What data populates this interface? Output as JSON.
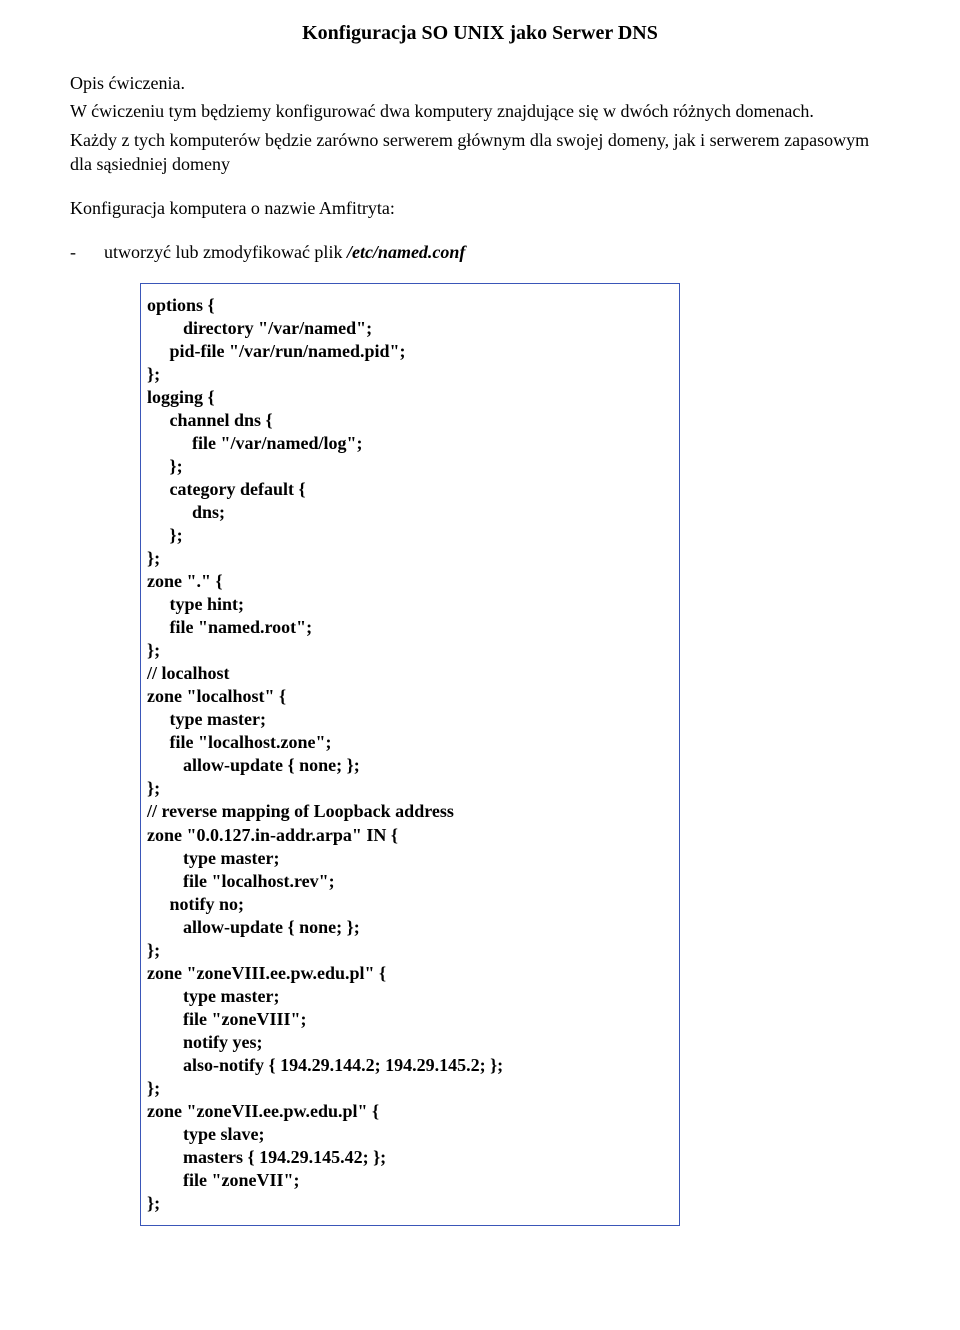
{
  "title": "Konfiguracja SO UNIX jako Serwer DNS",
  "intro": {
    "line1": "Opis ćwiczenia.",
    "line2": "W ćwiczeniu tym będziemy konfigurować dwa komputery znajdujące się w dwóch różnych domenach.",
    "line3": "Każdy z tych komputerów będzie zarówno serwerem głównym dla swojej domeny,  jak i serwerem zapasowym dla sąsiedniej domeny"
  },
  "section_heading": "Konfiguracja komputera o nazwie Amfitryta:",
  "bullet": {
    "dash": "-",
    "text_plain": "utworzyć lub zmodyfikować plik ",
    "text_italic": "/etc/named.conf"
  },
  "code": "options {\n        directory \"/var/named\";\n     pid-file \"/var/run/named.pid\";\n};\nlogging {\n     channel dns {\n          file \"/var/named/log\";\n     };\n     category default {\n          dns;\n     };\n};\nzone \".\" {\n     type hint;\n     file \"named.root\";\n};\n// localhost\nzone \"localhost\" {\n     type master;\n     file \"localhost.zone\";\n        allow-update { none; };\n};\n// reverse mapping of Loopback address\nzone \"0.0.127.in-addr.arpa\" IN {\n        type master;\n        file \"localhost.rev\";\n     notify no;\n        allow-update { none; };\n};\nzone \"zoneVIII.ee.pw.edu.pl\" {\n        type master;\n        file \"zoneVIII\";\n        notify yes;\n        also-notify { 194.29.144.2; 194.29.145.2; };\n};\nzone \"zoneVII.ee.pw.edu.pl\" {\n        type slave;\n        masters { 194.29.145.42; };\n        file \"zoneVII\";\n};"
}
